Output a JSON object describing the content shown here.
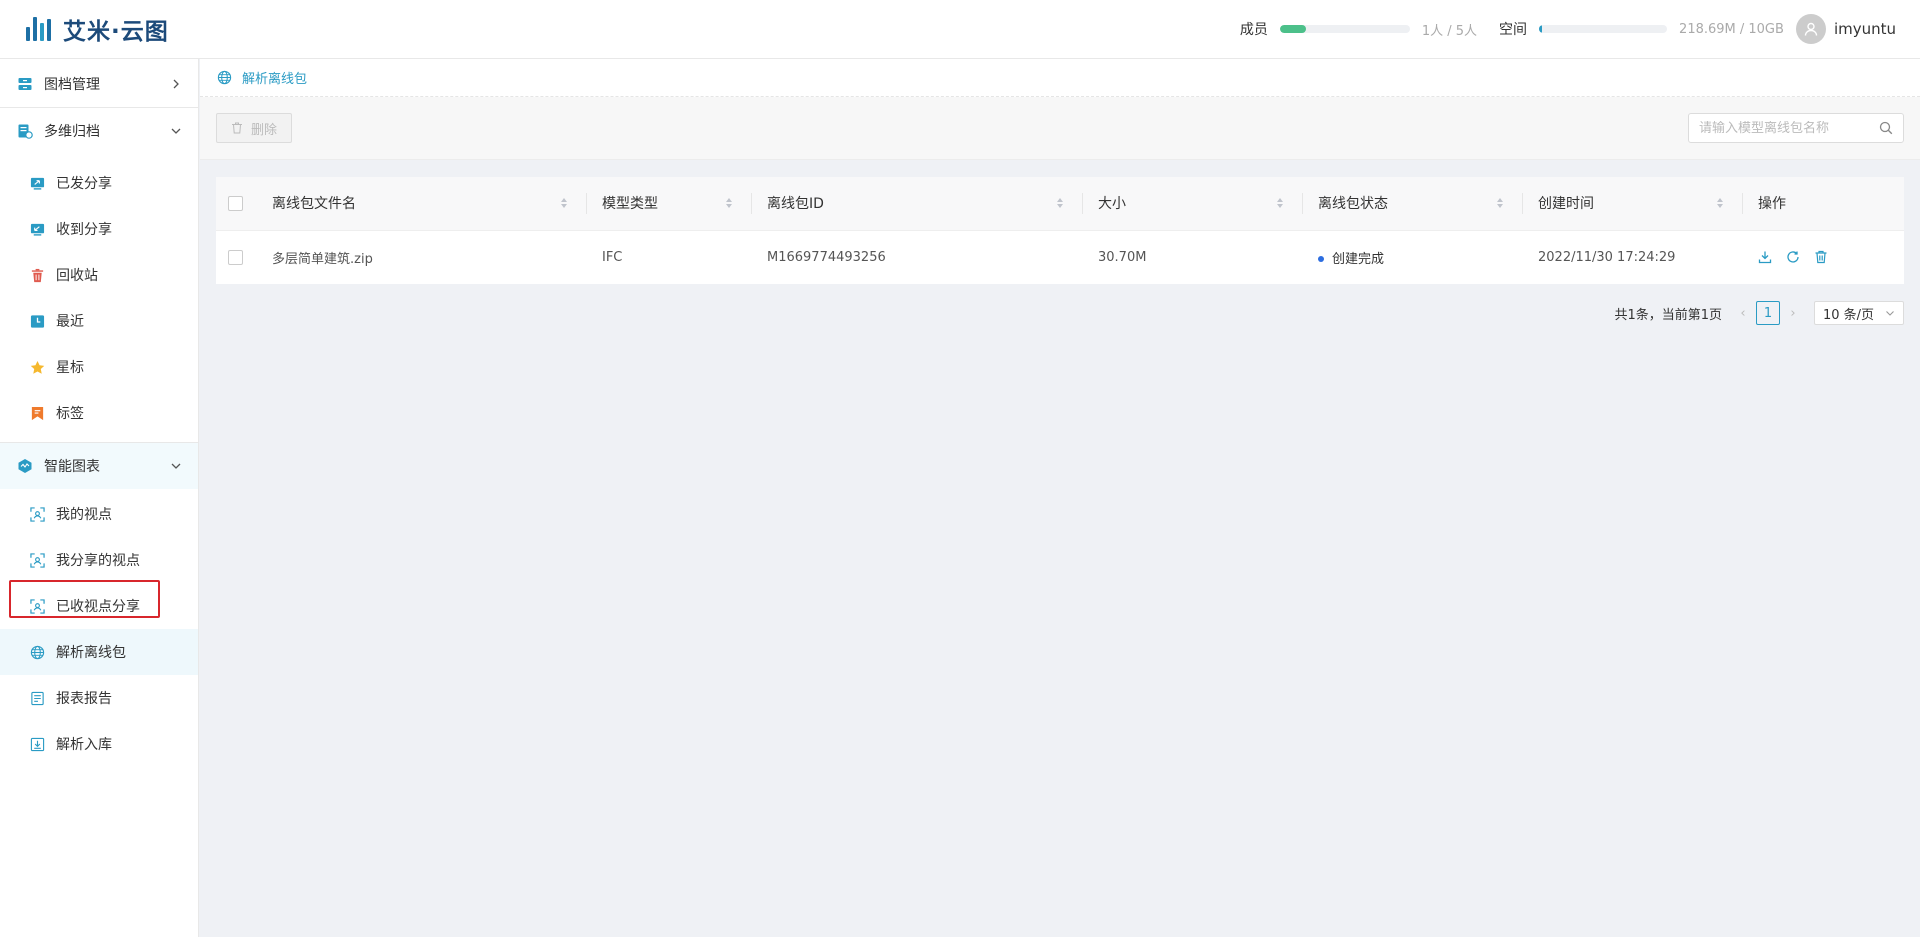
{
  "app": {
    "logo_text": "艾米·云图"
  },
  "header": {
    "members_label": "成员",
    "members_value": "1人 / 5人",
    "members_fraction": 0.2,
    "members_color": "#4cc08a",
    "space_label": "空间",
    "space_value": "218.69M / 10GB",
    "space_fraction": 0.02,
    "space_color": "#2a9bc4",
    "username": "imyuntu"
  },
  "sidebar": {
    "groups": [
      {
        "label": "图档管理",
        "icon": "archive-icon"
      },
      {
        "label": "多维归档",
        "icon": "multi-archive-icon",
        "items": [
          {
            "label": "已发分享",
            "icon": "share-sent-icon"
          },
          {
            "label": "收到分享",
            "icon": "share-received-icon"
          },
          {
            "label": "回收站",
            "icon": "trash-icon"
          },
          {
            "label": "最近",
            "icon": "clock-icon"
          },
          {
            "label": "星标",
            "icon": "star-icon"
          },
          {
            "label": "标签",
            "icon": "bookmark-icon"
          }
        ]
      },
      {
        "label": "智能图表",
        "icon": "smart-chart-icon",
        "items": [
          {
            "label": "我的视点",
            "icon": "viewpoint-icon"
          },
          {
            "label": "我分享的视点",
            "icon": "viewpoint-icon"
          },
          {
            "label": "已收视点分享",
            "icon": "viewpoint-icon"
          },
          {
            "label": "解析离线包",
            "icon": "globe-icon"
          },
          {
            "label": "报表报告",
            "icon": "report-icon"
          },
          {
            "label": "解析入库",
            "icon": "import-icon"
          }
        ]
      }
    ]
  },
  "breadcrumb": {
    "current": "解析离线包"
  },
  "toolbar": {
    "delete_label": "删除",
    "search_placeholder": "请输入模型离线包名称"
  },
  "table": {
    "columns": [
      "离线包文件名",
      "模型类型",
      "离线包ID",
      "大小",
      "离线包状态",
      "创建时间",
      "操作"
    ],
    "rows": [
      {
        "filename": "多层简单建筑.zip",
        "model_type": "IFC",
        "package_id": "M1669774493256",
        "size": "30.70M",
        "status": "创建完成",
        "created": "2022/11/30 17:24:29"
      }
    ]
  },
  "pagination": {
    "summary": "共1条，当前第1页",
    "current_page": "1",
    "page_size": "10 条/页"
  }
}
